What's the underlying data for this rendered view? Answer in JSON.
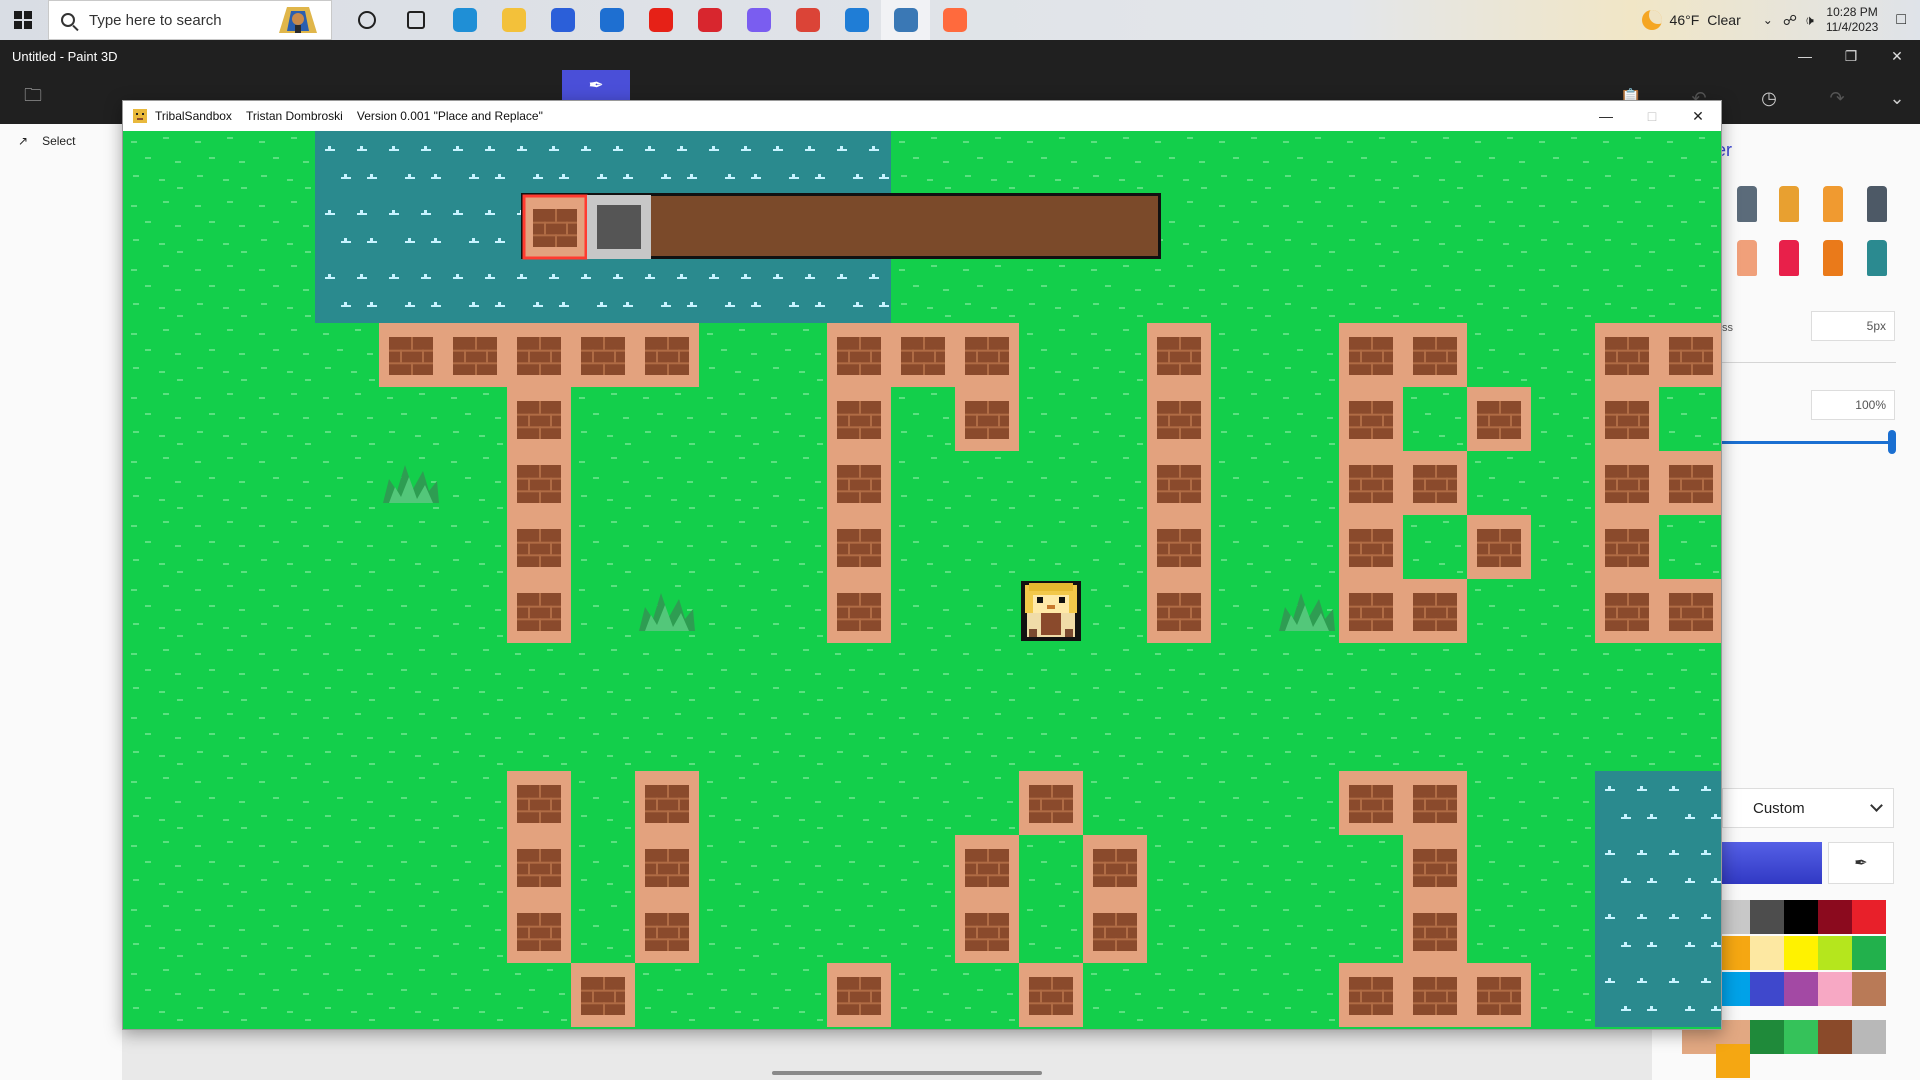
{
  "taskbar": {
    "search_placeholder": "Type here to search",
    "weather_temp": "46°F",
    "weather_desc": "Clear",
    "time": "10:28 PM",
    "date": "11/4/2023",
    "pinned": [
      {
        "name": "cortana-icon",
        "color": "#202020"
      },
      {
        "name": "task-view-icon",
        "color": "#202020"
      },
      {
        "name": "edge-icon",
        "color": "#1f8fd6"
      },
      {
        "name": "file-explorer-icon",
        "color": "#f3c13a"
      },
      {
        "name": "store-icon",
        "color": "#2b5fd9"
      },
      {
        "name": "mail-icon",
        "color": "#1e6fd1"
      },
      {
        "name": "youtube-icon",
        "color": "#e62117"
      },
      {
        "name": "red-app-icon",
        "color": "#d8262e"
      },
      {
        "name": "copilot-icon",
        "color": "#7a5df0"
      },
      {
        "name": "chrome-icon",
        "color": "#db4437"
      },
      {
        "name": "vscode-icon",
        "color": "#1f7dd6"
      },
      {
        "name": "python-icon",
        "color": "#3a78b5"
      },
      {
        "name": "paint3d-icon",
        "color": "#ff6a3d"
      }
    ]
  },
  "paint3d": {
    "title": "Untitled - Paint 3D",
    "select_label": "Select",
    "panel_title": "er",
    "thickness_label": "ss",
    "thickness_value": "5px",
    "opacity_value": "100%",
    "color_mode": "Custom",
    "palette": [
      "#c8c8c8",
      "#4d4d4d",
      "#000000",
      "#8b0a1e",
      "#e8202a",
      "#f5a712",
      "#fde8a2",
      "#fff200",
      "#b5e61d",
      "#22b14c",
      "#00a2e8",
      "#3f48cc",
      "#a349a4",
      "#f7a8c4",
      "#b97a57",
      "#e2a882",
      "#1f8a3a",
      "#35c25a",
      "#8a4a2a",
      "#b8b8b8",
      "#f5a712"
    ]
  },
  "game": {
    "window_title": "TribalSandbox",
    "author": "Tristan Dombroski",
    "version": "Version 0.001 \"Place and Replace\"",
    "hotbar": {
      "slots": [
        "brick-wall",
        "stone"
      ],
      "selected_slot": 0
    },
    "colors": {
      "grass": "#13cf4b",
      "grass_mark": "#5be080",
      "water": "#2a8a8e",
      "water_mark": "#c8f3ff",
      "brick_outer": "#e3a27e",
      "brick_inner": "#8a4a2c",
      "brick_line": "#b06c45",
      "hotbar_bg": "#7b4a2a",
      "selection": "#ff3b30",
      "stone": "#555555",
      "stone_border": "#c7c7c7"
    },
    "map": {
      "tile_size": 64,
      "rows": [
        "...WWWWWWWWW..............",
        "...WWWWWWWWW..............",
        "...WWWWWWWWW..............",
        "....BBBBB..BBB..B..BB..BB.",
        "......B....B.B..B..B.B.B..",
        "......B....B....B..BB..BB.",
        "......B....B....B..B.B.B..",
        "......B....B..P.B..BB..BB.",
        "........G.........G.......",
        "..........................",
        "......B.B.....B....BB..WWW",
        "......B.B....B.B....B..WWW",
        "......B.B....B.B....B..WWW",
        ".......B...B..B....BBB.WWW"
      ],
      "tufts": [
        [
          4,
          5
        ],
        [
          8,
          7
        ],
        [
          18,
          7
        ]
      ]
    }
  }
}
